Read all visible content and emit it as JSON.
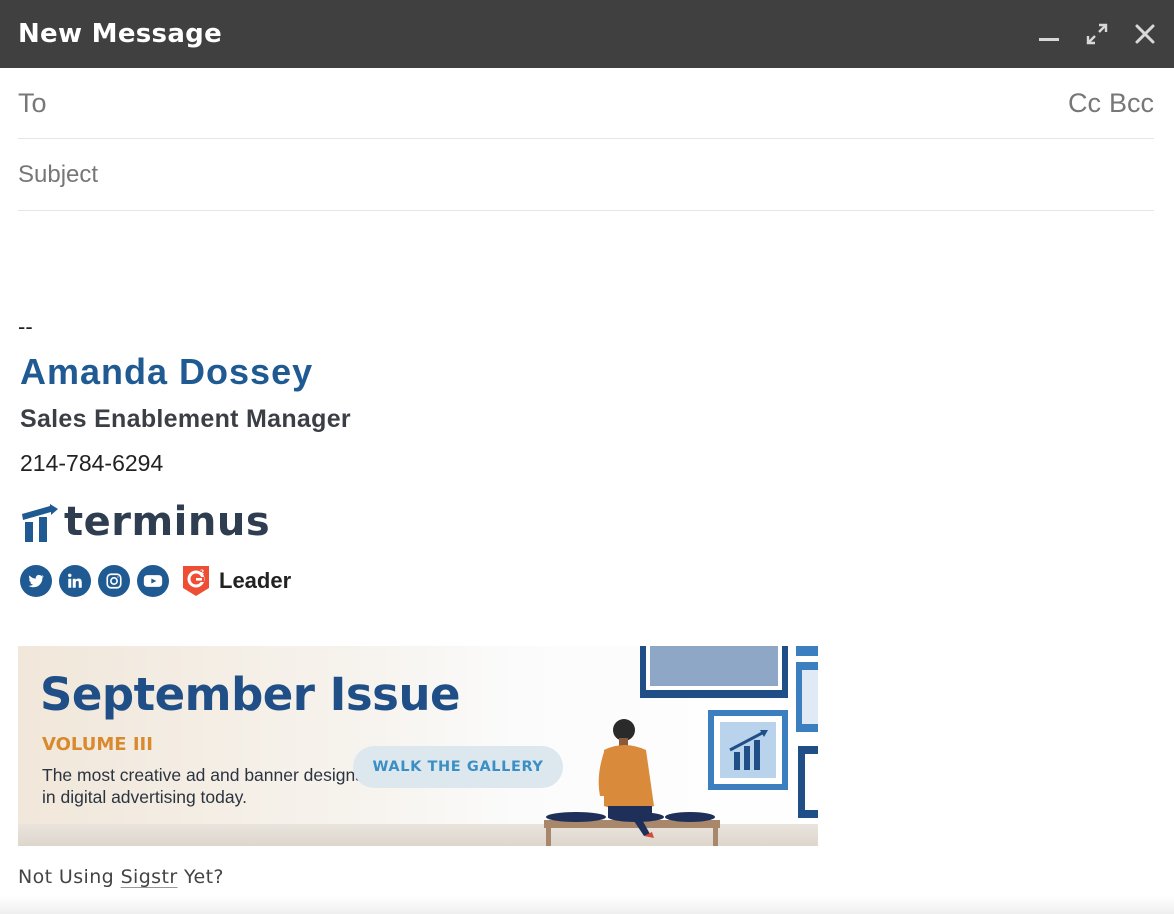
{
  "window": {
    "title": "New Message",
    "controls": [
      "minimize-icon",
      "expand-icon",
      "close-icon"
    ]
  },
  "compose": {
    "to_label": "To",
    "cc_label": "Cc",
    "bcc_label": "Bcc",
    "to_value": "",
    "subject_placeholder": "Subject",
    "subject_value": ""
  },
  "signature": {
    "separator": "--",
    "name": "Amanda Dossey",
    "role": "Sales Enablement Manager",
    "phone": "214-784-6294",
    "logo_text": "terminus",
    "social_icons": [
      "twitter-icon",
      "linkedin-icon",
      "instagram-icon",
      "youtube-icon"
    ],
    "badge_label": "Leader",
    "brand_color": "#1f5a93"
  },
  "banner": {
    "title": "September Issue",
    "volume": "VOLUME III",
    "description": "The most creative ad and banner designs in digital advertising today.",
    "button_label": "WALK THE GALLERY",
    "accent_color": "#d9892e"
  },
  "footer": {
    "prefix": "Not Using",
    "link": "Sigstr",
    "suffix": "Yet?"
  }
}
